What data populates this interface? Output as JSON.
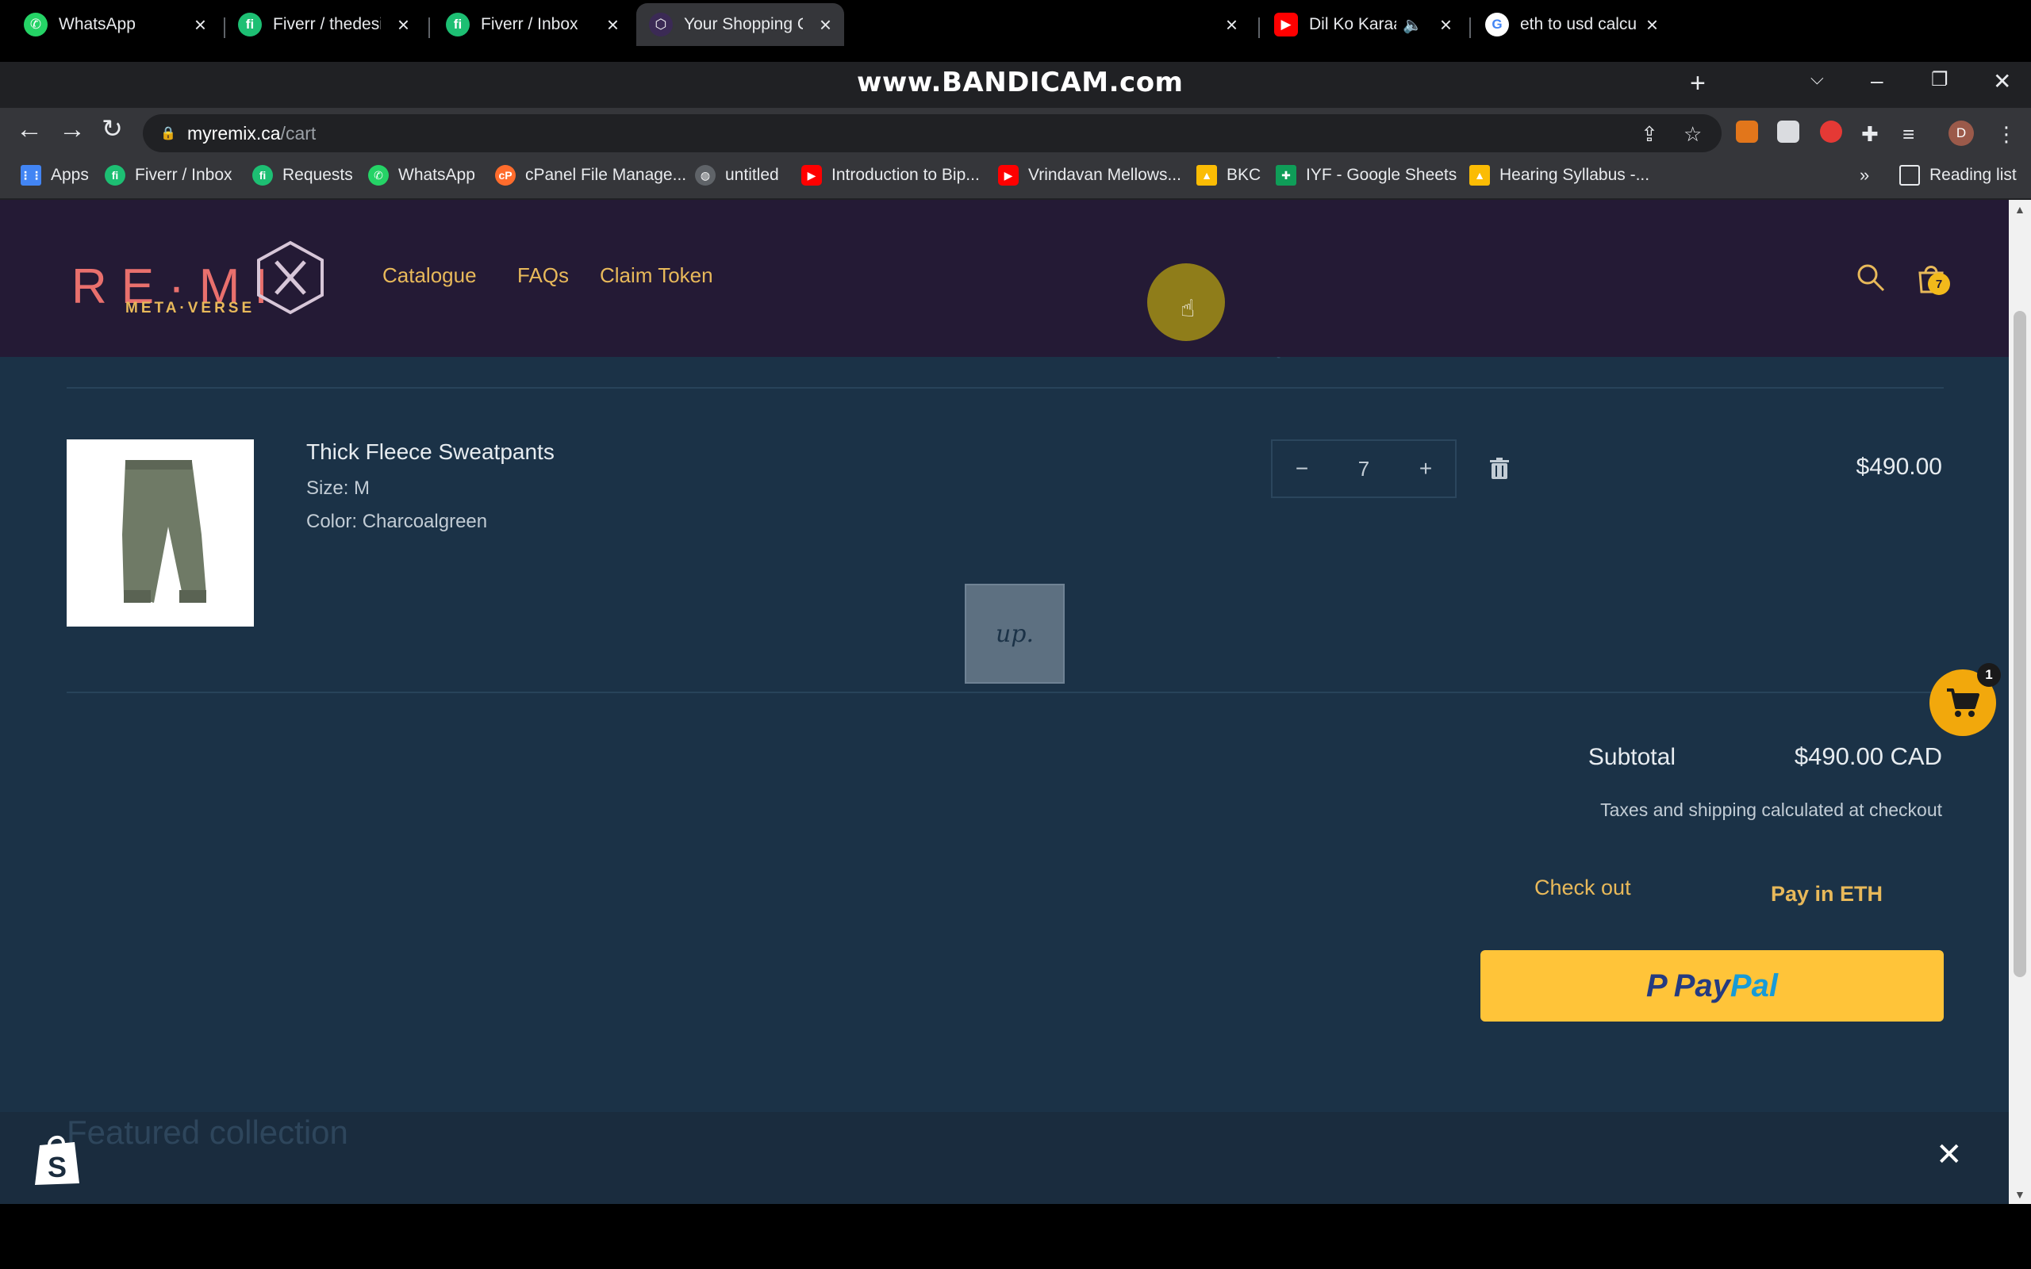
{
  "browser": {
    "tabs": [
      {
        "title": "WhatsApp",
        "icon": "whatsapp-icon",
        "color": "#25d366"
      },
      {
        "title": "Fiverr / thedesire",
        "icon": "fiverr-icon",
        "color": "#1dbf73"
      },
      {
        "title": "Fiverr / Inbox",
        "icon": "fiverr-icon",
        "color": "#1dbf73"
      },
      {
        "title": "Your Shopping Ca",
        "icon": "remix-icon",
        "color": "#3b2a55",
        "active": true
      },
      {
        "title": "Dil Ko Karaa",
        "icon": "youtube-icon",
        "color": "#ff0000"
      },
      {
        "title": "eth to usd calcula",
        "icon": "google-icon",
        "color": "#ffffff"
      }
    ],
    "watermark": "www.BANDICAM.com",
    "url_host": "myremix.ca",
    "url_path": "/cart",
    "profile_initial": "D",
    "bookmarks": [
      {
        "label": "Apps",
        "icon": "apps-icon",
        "color": "#4285f4"
      },
      {
        "label": "Fiverr / Inbox",
        "icon": "fiverr-icon",
        "color": "#1dbf73"
      },
      {
        "label": "Requests",
        "icon": "fiverr-icon",
        "color": "#1dbf73"
      },
      {
        "label": "WhatsApp",
        "icon": "whatsapp-icon",
        "color": "#25d366"
      },
      {
        "label": "cPanel File Manage...",
        "icon": "cpanel-icon",
        "color": "#ff6c2c"
      },
      {
        "label": "untitled",
        "icon": "globe-icon",
        "color": "#9aa0a6"
      },
      {
        "label": "Introduction to Bip...",
        "icon": "youtube-icon",
        "color": "#ff0000"
      },
      {
        "label": "Vrindavan Mellows...",
        "icon": "youtube-icon",
        "color": "#ff0000"
      },
      {
        "label": "BKC",
        "icon": "drive-icon",
        "color": "#fbbc04"
      },
      {
        "label": "IYF - Google Sheets",
        "icon": "sheets-icon",
        "color": "#0f9d58"
      },
      {
        "label": "Hearing Syllabus -...",
        "icon": "drive-icon",
        "color": "#fbbc04"
      }
    ],
    "reading_list": "Reading list"
  },
  "site": {
    "logo_word": "RE·MI",
    "logo_sub": "META·VERSE",
    "nav": [
      "Catalogue",
      "FAQs",
      "Claim Token"
    ],
    "cart_count": "7",
    "colors": {
      "header": "#241a35",
      "page": "#1b3247",
      "accent": "#e8b95a"
    }
  },
  "cart": {
    "item": {
      "title": "Thick Fleece Sweatpants",
      "size": "Size: M",
      "color": "Color: Charcoalgreen",
      "quantity": "7",
      "price": "$490.00"
    },
    "up_badge": "up.",
    "subtotal_label": "Subtotal",
    "subtotal_value": "$490.00 CAD",
    "tax_note": "Taxes and shipping calculated at checkout",
    "checkout_label": "Check out",
    "pay_eth_label": "Pay in ETH",
    "paypal_pay": "Pay",
    "paypal_pal": "Pal",
    "floating_cart_count": "1"
  },
  "featured": {
    "title": "Featured collection"
  }
}
